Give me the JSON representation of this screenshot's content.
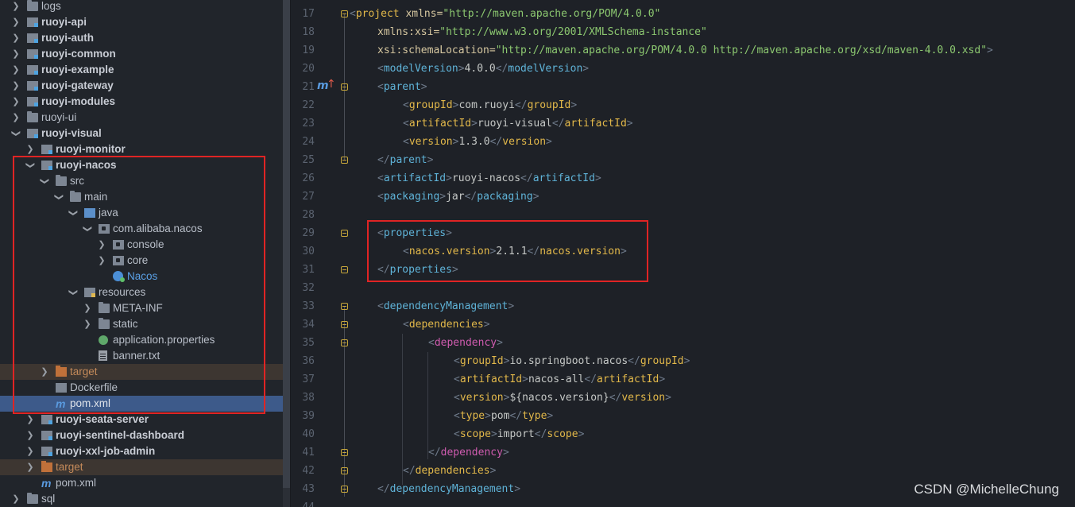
{
  "tree": {
    "items": [
      {
        "label": "logs"
      },
      {
        "label": "ruoyi-api"
      },
      {
        "label": "ruoyi-auth"
      },
      {
        "label": "ruoyi-common"
      },
      {
        "label": "ruoyi-example"
      },
      {
        "label": "ruoyi-gateway"
      },
      {
        "label": "ruoyi-modules"
      },
      {
        "label": "ruoyi-ui"
      },
      {
        "label": "ruoyi-visual"
      },
      {
        "label": "ruoyi-monitor"
      },
      {
        "label": "ruoyi-nacos"
      },
      {
        "label": "src"
      },
      {
        "label": "main"
      },
      {
        "label": "java"
      },
      {
        "label": "com.alibaba.nacos"
      },
      {
        "label": "console"
      },
      {
        "label": "core"
      },
      {
        "label": "Nacos"
      },
      {
        "label": "resources"
      },
      {
        "label": "META-INF"
      },
      {
        "label": "static"
      },
      {
        "label": "application.properties"
      },
      {
        "label": "banner.txt"
      },
      {
        "label": "target"
      },
      {
        "label": "Dockerfile"
      },
      {
        "label": "pom.xml"
      },
      {
        "label": "ruoyi-seata-server"
      },
      {
        "label": "ruoyi-sentinel-dashboard"
      },
      {
        "label": "ruoyi-xxl-job-admin"
      },
      {
        "label": "target"
      },
      {
        "label": "pom.xml"
      },
      {
        "label": "sql"
      }
    ]
  },
  "editor": {
    "line_numbers": [
      "17",
      "18",
      "19",
      "20",
      "21",
      "22",
      "23",
      "24",
      "25",
      "26",
      "27",
      "28",
      "29",
      "30",
      "31",
      "32",
      "33",
      "34",
      "35",
      "36",
      "37",
      "38",
      "39",
      "40",
      "41",
      "42",
      "43",
      "44"
    ],
    "xmlns_value": "\"http://maven.apache.org/POM/4.0.0\"",
    "xsi_value": "\"http://www.w3.org/2001/XMLSchema-instance\"",
    "schema_value": "\"http://maven.apache.org/POM/4.0.0 http://maven.apache.org/xsd/maven-4.0.0.xsd\"",
    "model_version": "4.0.0",
    "parent_group_id": "com.ruoyi",
    "parent_artifact_id": "ruoyi-visual",
    "parent_version": "1.3.0",
    "artifact_id": "ruoyi-nacos",
    "packaging": "jar",
    "nacos_version": "2.1.1",
    "dep_group_id": "io.springboot.nacos",
    "dep_artifact_id": "nacos-all",
    "dep_version": "${nacos.version}",
    "dep_type": "pom",
    "dep_scope": "import"
  },
  "watermark": "CSDN @MichelleChung"
}
